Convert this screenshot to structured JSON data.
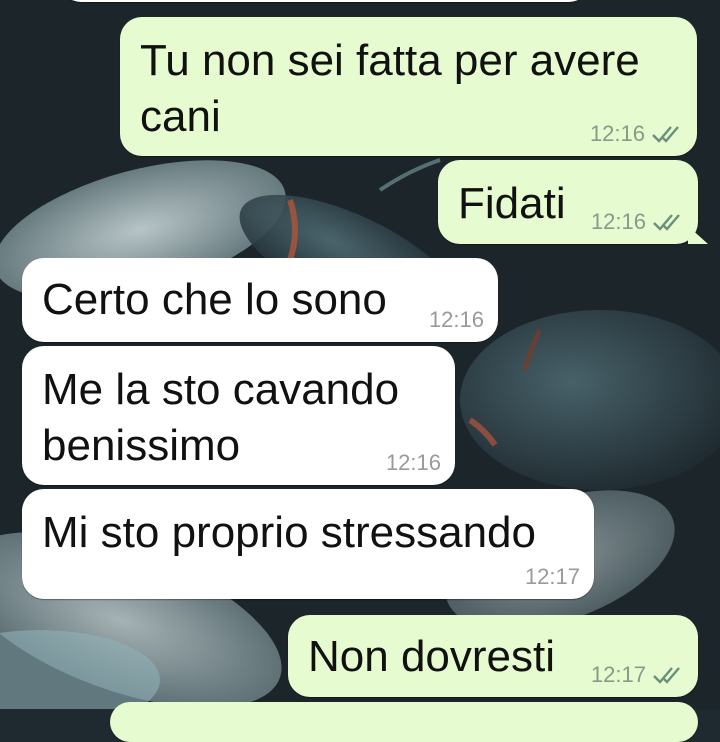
{
  "messages": [
    {
      "id": "m1",
      "direction": "out",
      "text": "Tu non sei fatta per avere\ncani",
      "time": "12:16",
      "status_icon": "double-check-icon"
    },
    {
      "id": "m2",
      "direction": "out",
      "text": "Fidati",
      "time": "12:16",
      "status_icon": "double-check-icon"
    },
    {
      "id": "m3",
      "direction": "in",
      "text": "Certo che lo sono",
      "time": "12:16"
    },
    {
      "id": "m4",
      "direction": "in",
      "text": "Me la sto cavando\nbenissimo",
      "time": "12:16"
    },
    {
      "id": "m5",
      "direction": "in",
      "text": "Mi sto proprio stressando",
      "time": "12:17"
    },
    {
      "id": "m6",
      "direction": "out",
      "text": "Non dovresti",
      "time": "12:17",
      "status_icon": "double-check-icon"
    }
  ],
  "colors": {
    "outgoing_bubble": "#e6fbcf",
    "incoming_bubble": "#ffffff",
    "tick_color": "#6b8f7b"
  }
}
